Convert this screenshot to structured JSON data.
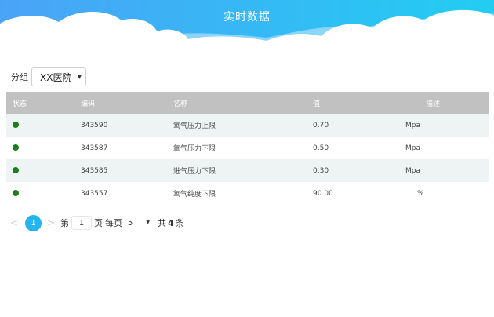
{
  "header": {
    "title": "实时数据",
    "gradient_start": "#47a6f7",
    "gradient_end": "#23cbf2"
  },
  "filter": {
    "group_label": "分组",
    "group_value": "XX医院"
  },
  "table": {
    "columns": [
      "状态",
      "编码",
      "名称",
      "值",
      "描述"
    ],
    "status_color": "#1a7f1a",
    "rows": [
      {
        "status": "online",
        "code": "343590",
        "name": "氧气压力上限",
        "value": "0.70",
        "unit": "Mpa"
      },
      {
        "status": "online",
        "code": "343587",
        "name": "氧气压力下限",
        "value": "0.50",
        "unit": "Mpa"
      },
      {
        "status": "online",
        "code": "343585",
        "name": "进气压力下限",
        "value": "0.30",
        "unit": "Mpa"
      },
      {
        "status": "online",
        "code": "343557",
        "name": "氧气纯度下限",
        "value": "90.00",
        "unit": "%"
      }
    ]
  },
  "pagination": {
    "prev_icon": "<",
    "next_icon": ">",
    "current_page": "1",
    "page_prefix": "第",
    "page_input": "1",
    "page_suffix": "页",
    "per_page_label": "每页",
    "per_page_value": "5",
    "total_prefix": "共",
    "total_count": "4",
    "total_suffix": "条",
    "accent": "#23b5ef"
  }
}
